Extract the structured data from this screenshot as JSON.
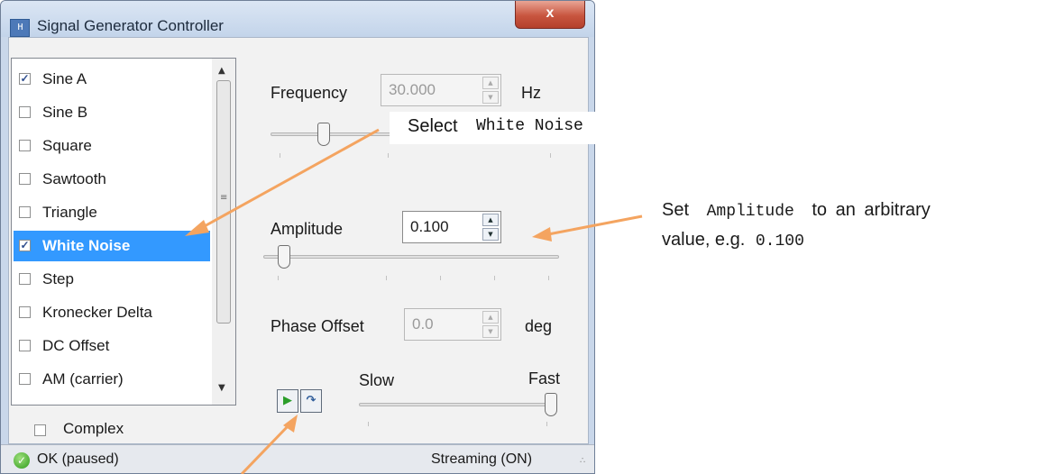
{
  "window": {
    "title": "Signal Generator Controller",
    "icon_text": "H",
    "close_label": "x"
  },
  "signal_list": {
    "items": [
      {
        "label": "Sine A",
        "checked": true
      },
      {
        "label": "Sine B",
        "checked": false
      },
      {
        "label": "Square",
        "checked": false
      },
      {
        "label": "Sawtooth",
        "checked": false
      },
      {
        "label": "Triangle",
        "checked": false
      },
      {
        "label": "White Noise",
        "checked": true,
        "selected": true
      },
      {
        "label": "Step",
        "checked": false
      },
      {
        "label": "Kronecker Delta",
        "checked": false
      },
      {
        "label": "DC Offset",
        "checked": false
      },
      {
        "label": "AM (carrier)",
        "checked": false
      }
    ]
  },
  "complex": {
    "label": "Complex",
    "checked": false
  },
  "frequency": {
    "label": "Frequency",
    "value": "30.000",
    "unit": "Hz",
    "enabled": false,
    "slider_fraction": 0.17
  },
  "amplitude": {
    "label": "Amplitude",
    "value": "0.100",
    "enabled": true,
    "slider_fraction": 0.05
  },
  "phase_offset": {
    "label": "Phase Offset",
    "value": "0.0",
    "unit": "deg",
    "enabled": false
  },
  "speed": {
    "slow_label": "Slow",
    "fast_label": "Fast",
    "slider_fraction": 1.0
  },
  "status": {
    "text": "OK (paused)",
    "streaming": "Streaming (ON)"
  },
  "callouts": {
    "select_prefix": "Select",
    "select_target": "White Noise",
    "amp_set": "Set",
    "amp_field": "Amplitude",
    "amp_rest": "to an arbitrary",
    "amp_value_prefix": "value, e.g.",
    "amp_value": "0.100"
  },
  "colors": {
    "accent": "#3399ff",
    "arrow": "#f4a460",
    "title_bar": "#c9d7ea",
    "close": "#c8553f"
  }
}
